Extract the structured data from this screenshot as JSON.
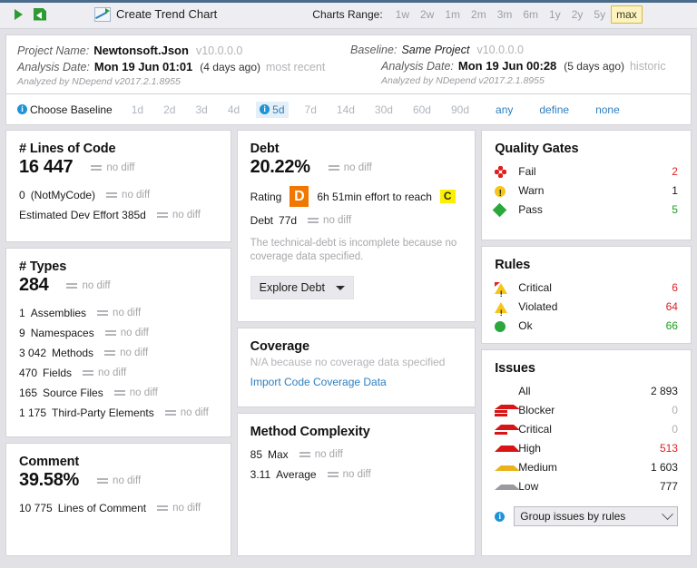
{
  "toolbar": {
    "run_icon": "play-icon",
    "export_icon": "export-report-icon",
    "create_trend_chart": "Create Trend Chart",
    "charts_range_label": "Charts Range:",
    "ranges": [
      "1w",
      "2w",
      "1m",
      "2m",
      "3m",
      "6m",
      "1y",
      "2y",
      "5y",
      "max"
    ],
    "selected_range": "max"
  },
  "header": {
    "left": {
      "project_name_label": "Project Name:",
      "project_name": "Newtonsoft.Json",
      "version": "v10.0.0.0",
      "analysis_date_label": "Analysis Date:",
      "analysis_date": "Mon 19 Jun  01:01",
      "analysis_ago": "(4 days ago)",
      "analysis_tag": "most recent",
      "analyzed_by": "Analyzed by NDepend v2017.2.1.8955"
    },
    "right": {
      "baseline_label": "Baseline:",
      "baseline_value": "Same Project",
      "version": "v10.0.0.0",
      "analysis_date_label": "Analysis Date:",
      "analysis_date": "Mon 19 Jun  00:28",
      "analysis_ago": "(5 days ago)",
      "analysis_tag": "historic",
      "analyzed_by": "Analyzed by NDepend v2017.2.1.8955"
    }
  },
  "baseline_bar": {
    "choose_label": "Choose Baseline",
    "options": [
      "1d",
      "2d",
      "3d",
      "4d",
      "5d",
      "7d",
      "14d",
      "30d",
      "60d",
      "90d"
    ],
    "selected": "5d",
    "links": [
      "any",
      "define",
      "none"
    ]
  },
  "lines_of_code": {
    "title": "# Lines of Code",
    "value": "16 447",
    "diff": "no diff",
    "rows": [
      {
        "num": "0",
        "label": "(NotMyCode)",
        "diff": "no diff"
      },
      {
        "num": "",
        "label": "Estimated Dev Effort   385d",
        "diff": "no diff"
      }
    ]
  },
  "types": {
    "title": "# Types",
    "value": "284",
    "diff": "no diff",
    "rows": [
      {
        "num": "1",
        "label": "Assemblies",
        "diff": "no diff"
      },
      {
        "num": "9",
        "label": "Namespaces",
        "diff": "no diff"
      },
      {
        "num": "3 042",
        "label": "Methods",
        "diff": "no diff"
      },
      {
        "num": "470",
        "label": "Fields",
        "diff": "no diff"
      },
      {
        "num": "165",
        "label": "Source Files",
        "diff": "no diff"
      },
      {
        "num": "1 175",
        "label": "Third-Party Elements",
        "diff": "no diff"
      }
    ]
  },
  "comment": {
    "title": "Comment",
    "value": "39.58%",
    "diff": "no diff",
    "rows": [
      {
        "num": "10 775",
        "label": "Lines of Comment",
        "diff": "no diff"
      }
    ]
  },
  "debt": {
    "title": "Debt",
    "value": "20.22%",
    "diff": "no diff",
    "rating_label": "Rating",
    "rating_badge": "D",
    "effort_text": "6h  51min effort to reach",
    "target_badge": "C",
    "debt_label": "Debt",
    "debt_value": "77d",
    "debt_diff": "no diff",
    "note": "The technical-debt is incomplete because no coverage data specified.",
    "explore_button": "Explore Debt",
    "badge_color": "#f07800",
    "target_color": "#fcf000"
  },
  "coverage": {
    "title": "Coverage",
    "subtitle": "N/A because no coverage data specified",
    "link": "Import Code Coverage Data"
  },
  "method_complexity": {
    "title": "Method Complexity",
    "rows": [
      {
        "num": "85",
        "label": "Max",
        "diff": "no diff"
      },
      {
        "num": "3.11",
        "label": "Average",
        "diff": "no diff"
      }
    ]
  },
  "quality_gates": {
    "title": "Quality Gates",
    "rows": [
      {
        "icon": "fail-diamond-icon",
        "label": "Fail",
        "value": "2",
        "color": "#e02020"
      },
      {
        "icon": "warn-circle-icon",
        "label": "Warn",
        "value": "1",
        "color": "#1a1a1a"
      },
      {
        "icon": "pass-diamond-icon",
        "label": "Pass",
        "value": "5",
        "color": "#19a019"
      }
    ]
  },
  "rules": {
    "title": "Rules",
    "rows": [
      {
        "icon": "critical-warning-icon",
        "label": "Critical",
        "value": "6",
        "color": "#e02020"
      },
      {
        "icon": "warning-triangle-icon",
        "label": "Violated",
        "value": "64",
        "color": "#e02020"
      },
      {
        "icon": "ok-circle-icon",
        "label": "Ok",
        "value": "66",
        "color": "#19a019"
      }
    ]
  },
  "issues": {
    "title": "Issues",
    "rows": [
      {
        "icon": "",
        "label": "All",
        "value": "2 893",
        "color": "#1a1a1a"
      },
      {
        "icon": "severity-blocker-icon",
        "label": "Blocker",
        "value": "0",
        "color": "#b0b0b5"
      },
      {
        "icon": "severity-critical-icon",
        "label": "Critical",
        "value": "0",
        "color": "#b0b0b5"
      },
      {
        "icon": "severity-high-icon",
        "label": "High",
        "value": "513",
        "color": "#e02020"
      },
      {
        "icon": "severity-medium-icon",
        "label": "Medium",
        "value": "1 603",
        "color": "#1a1a1a"
      },
      {
        "icon": "severity-low-icon",
        "label": "Low",
        "value": "777",
        "color": "#1a1a1a"
      }
    ],
    "group_select": "Group issues by rules"
  }
}
